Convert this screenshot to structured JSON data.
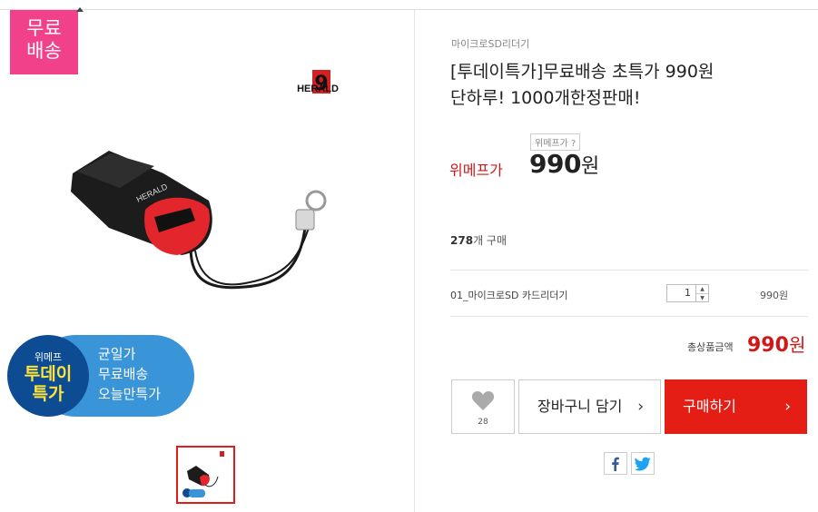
{
  "badge": {
    "line1": "무료",
    "line2": "배송"
  },
  "image": {
    "brand": "HERALD",
    "brand_number": "9"
  },
  "promo": {
    "small": "위메프",
    "big1": "투데이",
    "big2": "특가",
    "lines": [
      "균일가",
      "무료배송",
      "오늘만특가"
    ]
  },
  "product": {
    "category": "마이크로SD리더기",
    "title_line1": "[투데이특가]무료배송 초특가 990원",
    "title_line2": "단하루! 1000개한정판매!",
    "price_tip": "위메프가 ?",
    "price_label": "위메프가",
    "price": "990",
    "price_unit": "원",
    "buy_count": "278",
    "buy_count_suffix": "개 구매"
  },
  "option": {
    "name": "01_마이크로SD 카드리더기",
    "quantity": "1",
    "price": "990원"
  },
  "total": {
    "label": "총상품금액",
    "value": "990",
    "unit": "원"
  },
  "actions": {
    "likes": "28",
    "cart_label": "장바구니 담기",
    "buy_label": "구매하기",
    "arrow": "›"
  },
  "colors": {
    "accent_red": "#e41e15",
    "badge_pink": "#f2418b",
    "promo_blue": "#3a94d8",
    "promo_navy": "#0d4c92"
  },
  "icons": [
    "heart-icon",
    "facebook-icon",
    "twitter-icon",
    "chevron-right-icon"
  ]
}
